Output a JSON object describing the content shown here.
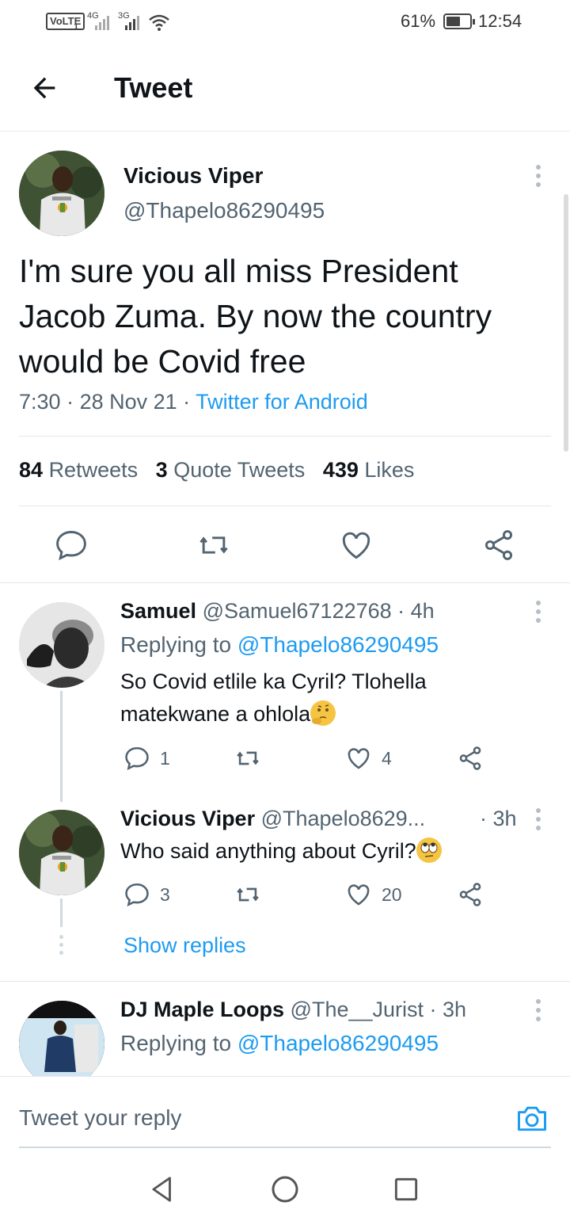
{
  "status_bar": {
    "volte": "VoLTE",
    "sim_slot": "1",
    "net1": "4G",
    "net2": "3G",
    "battery_pct": "61%",
    "battery_level": 0.61,
    "time": "12:54"
  },
  "header": {
    "title": "Tweet"
  },
  "tweet": {
    "name": "Vicious Viper",
    "handle": "@Thapelo86290495",
    "text": "I'm sure you all miss President Jacob Zuma. By now the country would be Covid free",
    "time": "7:30",
    "date": "28 Nov 21",
    "source": "Twitter for Android",
    "retweets_count": "84",
    "retweets_label": "Retweets",
    "quotes_count": "3",
    "quotes_label": "Quote Tweets",
    "likes_count": "439",
    "likes_label": "Likes"
  },
  "replies": [
    {
      "name": "Samuel",
      "handle": "@Samuel67122768",
      "age": "· 4h",
      "replying_prefix": "Replying to",
      "replying_to": "@Thapelo86290495",
      "text": "So Covid etlile ka Cyril? Tlohella matekwane a ohlola",
      "reply_count": "1",
      "like_count": "4"
    },
    {
      "name": "Vicious Viper",
      "handle": "@Thapelo8629...",
      "age": "· 3h",
      "text": "Who said anything about Cyril?",
      "reply_count": "3",
      "like_count": "20",
      "show_replies": "Show replies"
    },
    {
      "name": "DJ Maple Loops",
      "handle": "@The__Jurist",
      "age": "· 3h",
      "replying_prefix": "Replying to",
      "replying_to": "@Thapelo86290495"
    }
  ],
  "reply_bar": {
    "placeholder": "Tweet your reply"
  },
  "icons": {
    "back": "arrow-left-icon",
    "more": "more-vertical-icon",
    "reply": "comment-icon",
    "retweet": "retweet-icon",
    "like": "heart-icon",
    "share": "share-icon",
    "camera": "camera-icon"
  },
  "colors": {
    "accent": "#1d9bf0",
    "text": "#0f1419",
    "muted": "#536471"
  }
}
